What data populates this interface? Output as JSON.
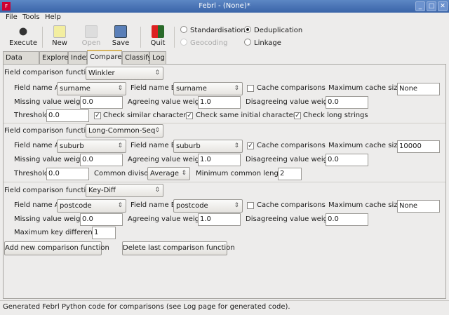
{
  "window": {
    "title": "Febrl - (None)*"
  },
  "menu": [
    "File",
    "Tools",
    "Help"
  ],
  "toolbar": {
    "execute": "Execute",
    "new": "New",
    "open": "Open",
    "save": "Save",
    "quit": "Quit"
  },
  "modes": {
    "standardisation": "Standardisation",
    "deduplication": "Deduplication",
    "geocoding": "Geocoding",
    "linkage": "Linkage",
    "selected": "Deduplication"
  },
  "tabs": [
    "Data",
    "Explore",
    "Index",
    "Compare",
    "Classify",
    "Log"
  ],
  "labels": {
    "func": "Field comparison function:",
    "fa": "Field name A:",
    "fb": "Field name B:",
    "cache": "Cache comparisons",
    "maxcache": "Maximum cache size:",
    "missing": "Missing value weight:",
    "agree": "Agreeing value weight:",
    "disagree": "Disagreeing value weight:",
    "threshold": "Threshold:",
    "similar": "Check similar characters",
    "initial": "Check same initial characters",
    "long": "Check long strings",
    "divisor": "Common divisor:",
    "minlen": "Minimum common length:",
    "maxkey": "Maximum key difference:"
  },
  "comparisons": [
    {
      "function": "Winkler",
      "field_a": "surname",
      "field_b": "surname",
      "cache": false,
      "max_cache": "None",
      "missing": "0.0",
      "agree": "1.0",
      "disagree": "0.0",
      "threshold": "0.0",
      "similar": true,
      "initial": true,
      "long": true
    },
    {
      "function": "Long-Common-Seq",
      "field_a": "suburb",
      "field_b": "suburb",
      "cache": true,
      "max_cache": "10000",
      "missing": "0.0",
      "agree": "1.0",
      "disagree": "0.0",
      "threshold": "0.0",
      "divisor": "Average",
      "minlen": "2"
    },
    {
      "function": "Key-Diff",
      "field_a": "postcode",
      "field_b": "postcode",
      "cache": false,
      "max_cache": "None",
      "missing": "0.0",
      "agree": "1.0",
      "disagree": "0.0",
      "maxkey": "1"
    }
  ],
  "buttons": {
    "add": "Add new comparison function",
    "delete": "Delete last comparison function"
  },
  "status": "Generated Febrl Python code for comparisons (see Log page for generated code)."
}
